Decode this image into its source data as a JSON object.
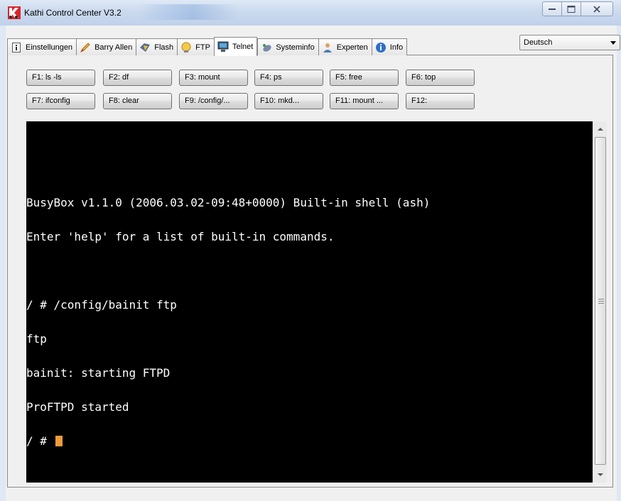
{
  "window": {
    "title": "Kathi Control Center V3.2"
  },
  "tabs": [
    {
      "label": "Einstellungen",
      "icon": "info-page-icon"
    },
    {
      "label": "Barry Allen",
      "icon": "pen-icon"
    },
    {
      "label": "Flash",
      "icon": "flash-icon"
    },
    {
      "label": "FTP",
      "icon": "ftp-globe-icon"
    },
    {
      "label": "Telnet",
      "icon": "terminal-icon",
      "active": true
    },
    {
      "label": "Systeminfo",
      "icon": "satellite-icon"
    },
    {
      "label": "Experten",
      "icon": "user-icon"
    },
    {
      "label": "Info",
      "icon": "info-icon"
    }
  ],
  "language": {
    "selected": "Deutsch"
  },
  "buttons": {
    "row1": [
      "F1: ls -ls",
      "F2: df",
      "F3: mount",
      "F4: ps",
      "F5: free",
      "F6: top"
    ],
    "row2": [
      "F7: ifconfig",
      "F8: clear",
      "F9: /config/...",
      "F10: mkd...",
      "F11: mount ...",
      "F12:"
    ]
  },
  "terminal": {
    "lines": [
      "BusyBox v1.1.0 (2006.03.02-09:48+0000) Built-in shell (ash)",
      "Enter 'help' for a list of built-in commands.",
      "",
      "/ # /config/bainit ftp",
      "ftp",
      "bainit: starting FTPD",
      "ProFTPD started",
      "/ # "
    ]
  },
  "colors": {
    "terminal_bg": "#000000",
    "terminal_fg": "#ffffff",
    "cursor": "#f29a3c"
  }
}
